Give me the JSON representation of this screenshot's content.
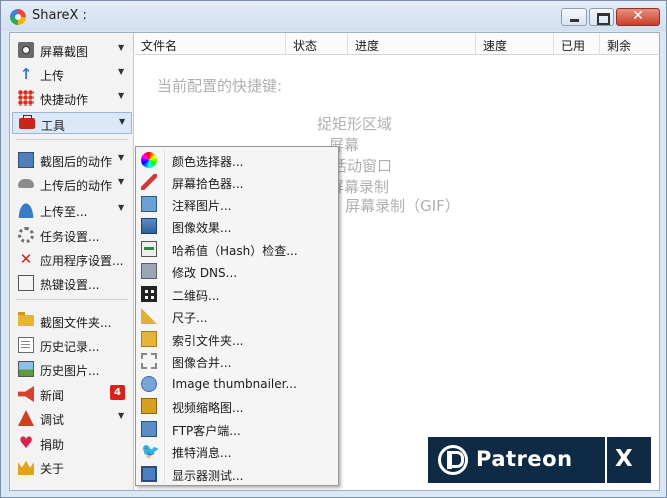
{
  "window": {
    "title": "ShareX :"
  },
  "sidebar": {
    "items": [
      {
        "label": "屏幕截图",
        "icon": "camera-icon",
        "arrow": true
      },
      {
        "label": "上传",
        "icon": "upload-arrow-icon",
        "arrow": true
      },
      {
        "label": "快捷动作",
        "icon": "dot-grid-icon",
        "arrow": true
      },
      {
        "label": "工具",
        "icon": "toolbox-icon",
        "arrow": true,
        "active": true
      },
      {
        "label": "截图后的动作",
        "icon": "monitor-icon",
        "arrow": true
      },
      {
        "label": "上传后的动作",
        "icon": "cloud-icon",
        "arrow": true
      },
      {
        "label": "上传至...",
        "icon": "person-icon",
        "arrow": true
      },
      {
        "label": "任务设置...",
        "icon": "gear-icon",
        "arrow": false
      },
      {
        "label": "应用程序设置...",
        "icon": "wrench-icon",
        "arrow": false
      },
      {
        "label": "热键设置...",
        "icon": "keyboard-icon",
        "arrow": false
      },
      {
        "label": "截图文件夹...",
        "icon": "folder-icon",
        "arrow": false
      },
      {
        "label": "历史记录...",
        "icon": "history-icon",
        "arrow": false
      },
      {
        "label": "历史图片...",
        "icon": "image-history-icon",
        "arrow": false
      },
      {
        "label": "新闻",
        "icon": "megaphone-icon",
        "arrow": false,
        "badge": "4"
      },
      {
        "label": "调试",
        "icon": "debug-icon",
        "arrow": true
      },
      {
        "label": "捐助",
        "icon": "heart-icon",
        "arrow": false
      },
      {
        "label": "关于",
        "icon": "crown-icon",
        "arrow": false
      }
    ]
  },
  "list": {
    "columns": [
      "文件名",
      "状态",
      "进度",
      "速度",
      "已用",
      "剩余"
    ]
  },
  "hotkeys": {
    "title": "当前配置的快捷键:",
    "fragments": [
      "捉矩形区域",
      "屏幕",
      "捉活动窗口",
      "屏幕录制",
      "n | 屏幕录制（GIF）"
    ]
  },
  "tools_menu": {
    "items": [
      {
        "label": "颜色选择器...",
        "icon": "color-wheel-icon"
      },
      {
        "label": "屏幕拾色器...",
        "icon": "color-picker-icon"
      },
      {
        "label": "注释图片...",
        "icon": "annotate-icon"
      },
      {
        "label": "图像效果...",
        "icon": "image-effects-icon"
      },
      {
        "label": "哈希值（Hash）检查...",
        "icon": "hash-check-icon"
      },
      {
        "label": "修改 DNS...",
        "icon": "dns-icon"
      },
      {
        "label": "二维码...",
        "icon": "qr-code-icon"
      },
      {
        "label": "尺子...",
        "icon": "ruler-icon"
      },
      {
        "label": "索引文件夹...",
        "icon": "index-folder-icon"
      },
      {
        "label": "图像合并...",
        "icon": "image-combiner-icon"
      },
      {
        "label": "Image thumbnailer...",
        "icon": "thumbnailer-icon"
      },
      {
        "label": "视频缩略图...",
        "icon": "video-thumbnail-icon"
      },
      {
        "label": "FTP客户端...",
        "icon": "ftp-client-icon"
      },
      {
        "label": "推特消息...",
        "icon": "twitter-icon"
      },
      {
        "label": "显示器测试...",
        "icon": "monitor-test-icon"
      }
    ]
  },
  "patreon": {
    "text": "Patreon",
    "x": "X"
  },
  "colors": {
    "titlebar": "#d2dff0",
    "active_item": "#dbe8f8",
    "patreon_bg": "#0f2a44",
    "badge": "#d9211d"
  }
}
